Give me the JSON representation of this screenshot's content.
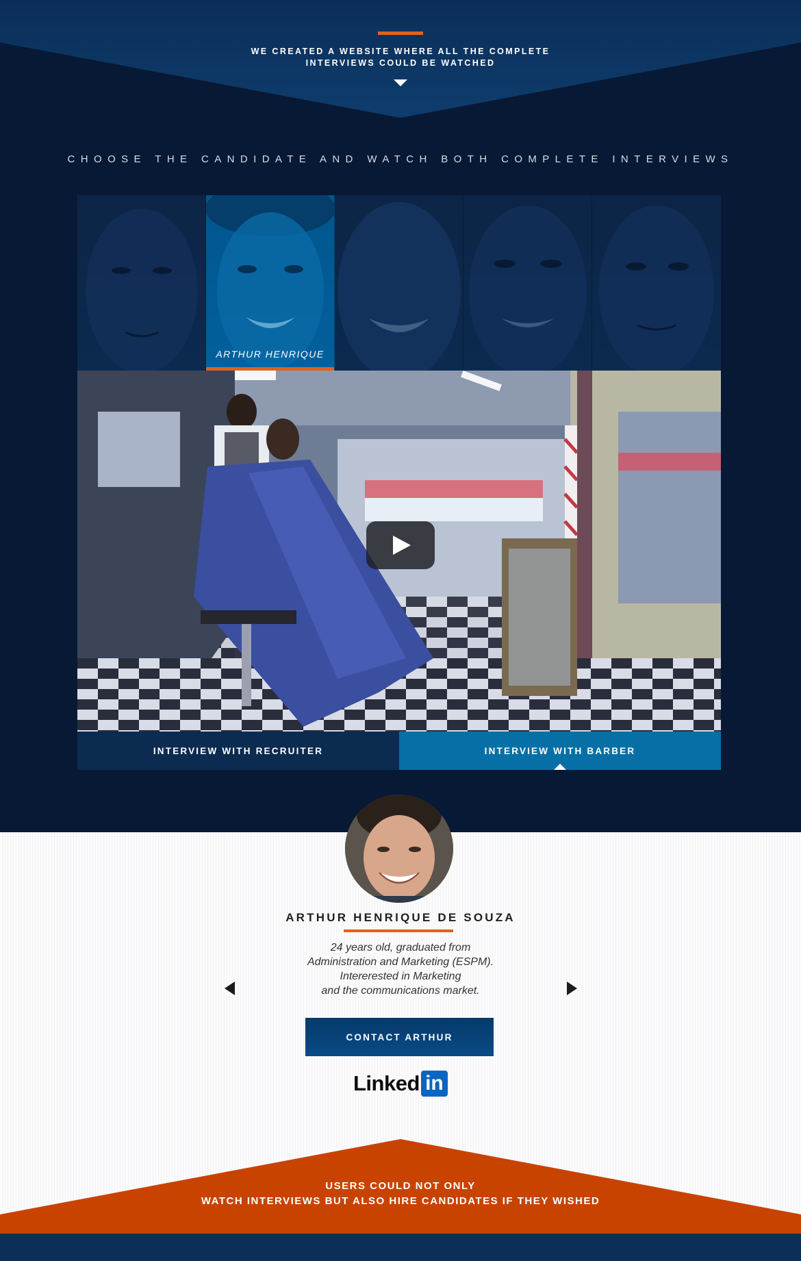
{
  "banner": {
    "text": "WE CREATED A WEBSITE WHERE ALL THE COMPLETE INTERVIEWS COULD BE WATCHED",
    "accent_color": "#e0621c"
  },
  "section": {
    "heading": "CHOOSE THE CANDIDATE AND WATCH BOTH COMPLETE INTERVIEWS"
  },
  "candidates": [
    {
      "id": "candidate-1",
      "name": "",
      "active": false
    },
    {
      "id": "candidate-2",
      "name": "ARTHUR HENRIQUE",
      "active": true
    },
    {
      "id": "candidate-3",
      "name": "",
      "active": false
    },
    {
      "id": "candidate-4",
      "name": "",
      "active": false
    },
    {
      "id": "candidate-5",
      "name": "",
      "active": false
    }
  ],
  "video": {
    "play_icon": "play-icon"
  },
  "tabs": [
    {
      "label": "INTERVIEW WITH RECRUITER",
      "active": false
    },
    {
      "label": "INTERVIEW WITH BARBER",
      "active": true
    }
  ],
  "profile": {
    "name": "ARTHUR HENRIQUE DE SOUZA",
    "bio": [
      "24 years old, graduated from",
      "Administration and Marketing (ESPM).",
      "Intererested in Marketing",
      "and the communications market."
    ],
    "contact_label": "CONTACT ARTHUR",
    "linkedin": {
      "text": "Linked",
      "box": "in"
    }
  },
  "footer": {
    "lines": [
      "USERS COULD NOT ONLY",
      "WATCH INTERVIEWS BUT ALSO HIRE CANDIDATES IF THEY WISHED"
    ],
    "color": "#c94300"
  },
  "colors": {
    "navy_dark": "#071934",
    "navy": "#0b2b51",
    "blue": "#0670a6",
    "orange": "#e0621c"
  }
}
